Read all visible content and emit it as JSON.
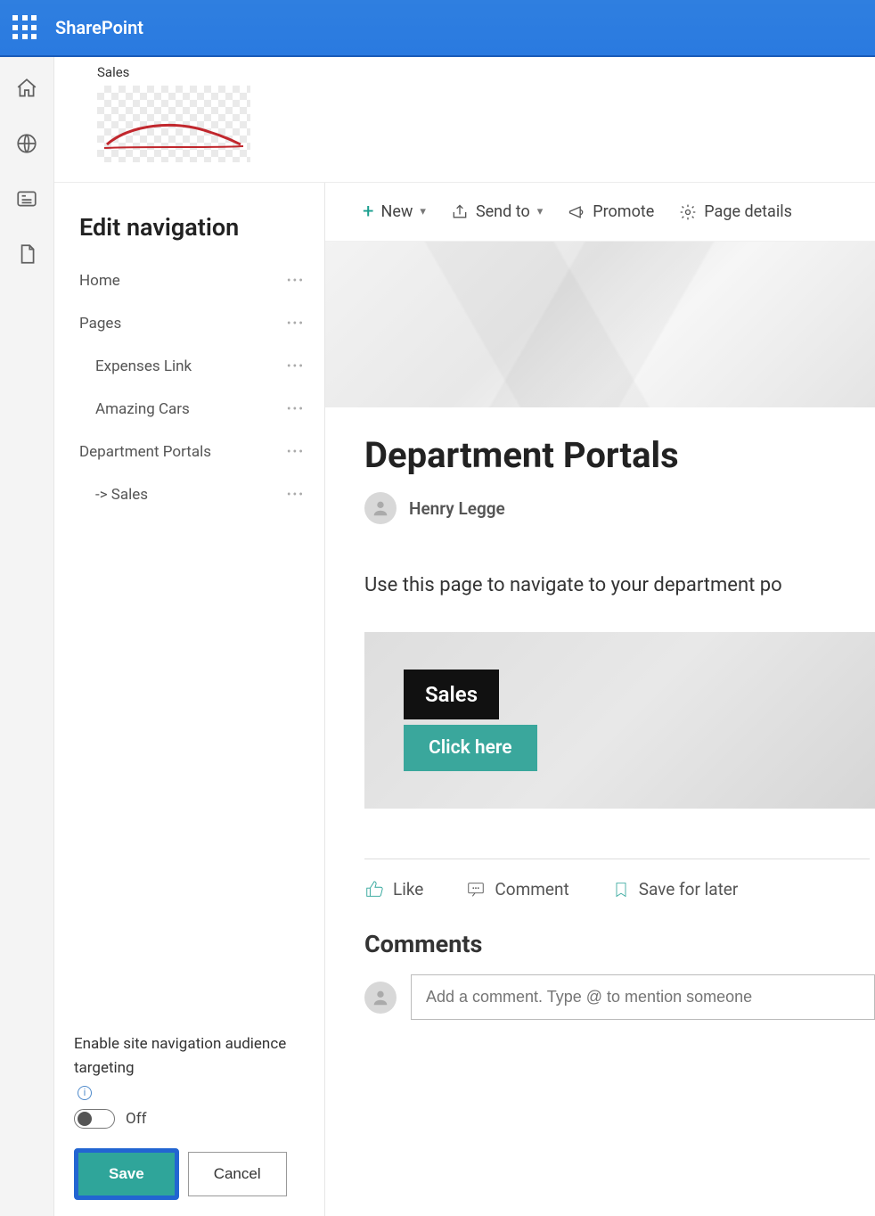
{
  "topbar": {
    "app_name": "SharePoint"
  },
  "site": {
    "title": "Sales"
  },
  "nav": {
    "heading": "Edit navigation",
    "items": [
      {
        "label": "Home",
        "indent": false
      },
      {
        "label": "Pages",
        "indent": false
      },
      {
        "label": "Expenses Link",
        "indent": true
      },
      {
        "label": "Amazing Cars",
        "indent": true
      },
      {
        "label": "Department Portals",
        "indent": false
      },
      {
        "label": "-> Sales",
        "indent": true
      }
    ],
    "toggle_label": "Enable site navigation audience targeting",
    "toggle_state": "Off",
    "save_label": "Save",
    "cancel_label": "Cancel"
  },
  "cmdbar": {
    "new": "New",
    "send": "Send to",
    "promote": "Promote",
    "details": "Page details"
  },
  "page": {
    "title": "Department Portals",
    "author": "Henry Legge",
    "body": "Use this page to navigate to your department po",
    "card_title": "Sales",
    "card_cta": "Click here"
  },
  "social": {
    "like": "Like",
    "comment": "Comment",
    "save": "Save for later"
  },
  "comments": {
    "heading": "Comments",
    "placeholder": "Add a comment. Type @ to mention someone"
  }
}
